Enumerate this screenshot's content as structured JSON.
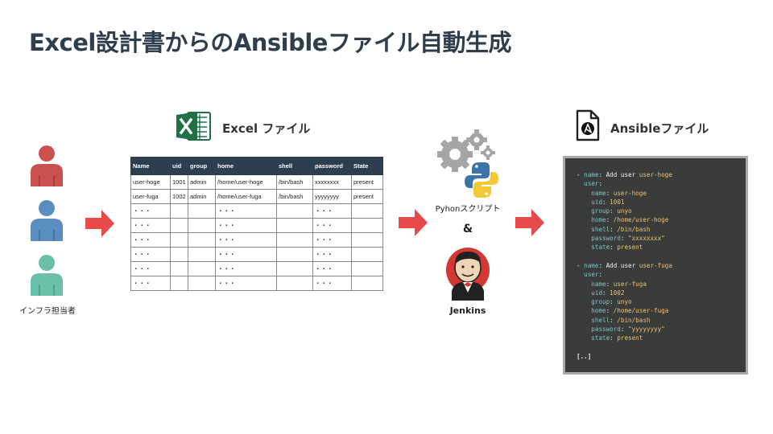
{
  "title": "Excel設計書からのAnsibleファイル自動生成",
  "infra": {
    "label": "インフラ担当者",
    "colors": [
      "#c9514f",
      "#5b8ec0",
      "#6cbfa8"
    ]
  },
  "excel": {
    "title": "Excel ファイル",
    "icon": "excel-icon",
    "headers": [
      "Name",
      "uid",
      "group",
      "home",
      "shell",
      "password",
      "State"
    ],
    "rows": [
      [
        "user-hoge",
        "1001",
        "admin",
        "/home/user-hoge",
        "/bin/bash",
        "xxxxxxxx",
        "present"
      ],
      [
        "user-fuga",
        "1002",
        "admin",
        "/home/user-fuga",
        "/bin/bash",
        "yyyyyyyy",
        "present"
      ],
      [
        "・・・",
        "",
        "",
        "・・・",
        "",
        "・・・",
        ""
      ],
      [
        "・・・",
        "",
        "",
        "・・・",
        "",
        "・・・",
        ""
      ],
      [
        "・・・",
        "",
        "",
        "・・・",
        "",
        "・・・",
        ""
      ],
      [
        "・・・",
        "",
        "",
        "・・・",
        "",
        "・・・",
        ""
      ],
      [
        "・・・",
        "",
        "",
        "・・・",
        "",
        "・・・",
        ""
      ],
      [
        "・・・",
        "",
        "",
        "・・・",
        "",
        "・・・",
        ""
      ]
    ]
  },
  "script": {
    "label": "Pyhonスクリプト",
    "amp": "&",
    "jenkins": "Jenkins"
  },
  "ansible": {
    "title": "Ansibleファイル",
    "icon": "ansible-file-icon",
    "blocks": [
      {
        "dash": "- ",
        "name_key": "name",
        "name_value": "Add user user-hoge",
        "user_key": "user",
        "fields": [
          {
            "key": "name",
            "value": "user-hoge"
          },
          {
            "key": "uid",
            "value": "1001"
          },
          {
            "key": "group",
            "value": "unyo"
          },
          {
            "key": "home",
            "value": "/home/user-hoge"
          },
          {
            "key": "shell",
            "value": "/bin/bash"
          },
          {
            "key": "password",
            "value": "\"xxxxxxxx\""
          },
          {
            "key": "state",
            "value": "present"
          }
        ]
      },
      {
        "dash": "- ",
        "name_key": "name",
        "name_value": "Add user user-fuga",
        "user_key": "user",
        "fields": [
          {
            "key": "name",
            "value": "user-fuga"
          },
          {
            "key": "uid",
            "value": "1002"
          },
          {
            "key": "group",
            "value": "unyo"
          },
          {
            "key": "home",
            "value": "/home/user-fuga"
          },
          {
            "key": "shell",
            "value": "/bin/bash"
          },
          {
            "key": "password",
            "value": "\"yyyyyyyy\""
          },
          {
            "key": "state",
            "value": "present"
          }
        ]
      }
    ],
    "ellipsis": "[..]"
  },
  "arrow_color": "#e84a4a"
}
